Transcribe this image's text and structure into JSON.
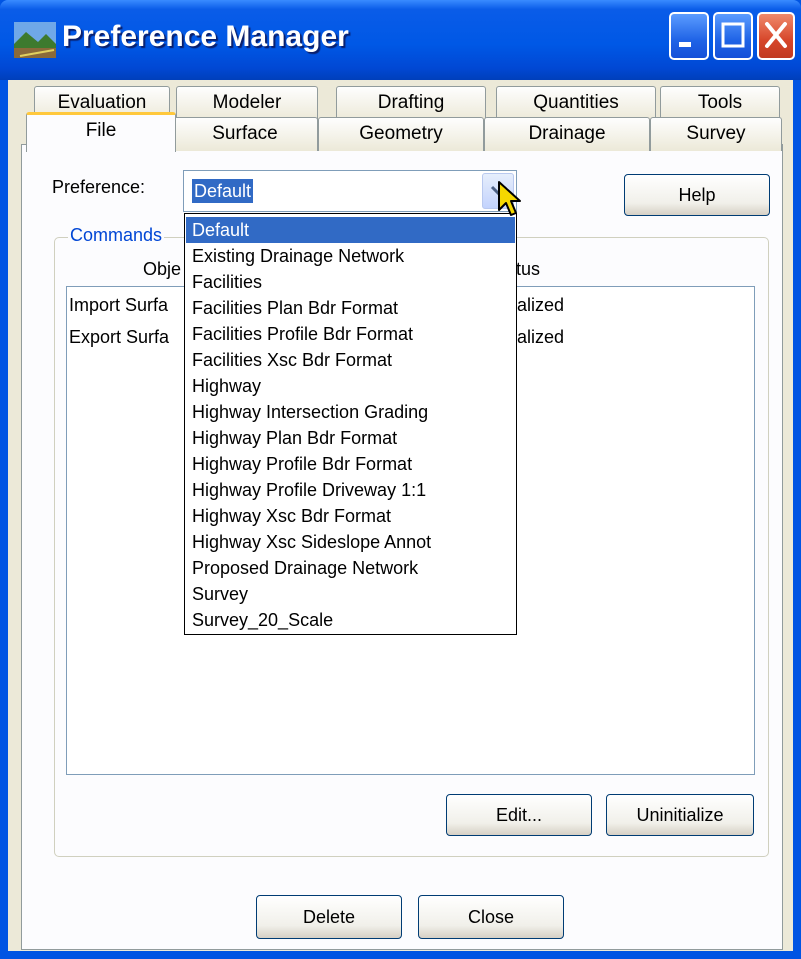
{
  "window": {
    "title": "Preference Manager"
  },
  "tabs_back": [
    "Evaluation",
    "Modeler",
    "Drafting",
    "Quantities",
    "Tools"
  ],
  "tabs_front": [
    "File",
    "Surface",
    "Geometry",
    "Drainage",
    "Survey"
  ],
  "active_tab": "File",
  "preference": {
    "label": "Preference:",
    "value": "Default"
  },
  "help_button": "Help",
  "commands": {
    "group_title": "Commands",
    "columns": [
      "Obje",
      "tus"
    ],
    "rows": [
      {
        "object": "Import Surfa",
        "status": "alized"
      },
      {
        "object": "Export Surfa",
        "status": "alized"
      }
    ]
  },
  "dropdown_options": [
    "Default",
    "Existing Drainage Network",
    "Facilities",
    "Facilities Plan Bdr Format",
    "Facilities Profile Bdr Format",
    "Facilities Xsc Bdr Format",
    "Highway",
    "Highway Intersection Grading",
    "Highway Plan Bdr Format",
    "Highway Profile Bdr Format",
    "Highway Profile Driveway 1:1",
    "Highway Xsc Bdr Format",
    "Highway Xsc Sideslope Annot",
    "Proposed Drainage Network",
    "Survey",
    "Survey_20_Scale"
  ],
  "buttons": {
    "edit": "Edit...",
    "uninitialize": "Uninitialize",
    "delete": "Delete",
    "close": "Close"
  },
  "colors": {
    "title_bar": "#0054e3",
    "selection": "#316ac5",
    "dialog_bg": "#ece9d8",
    "group_title": "#0046d5"
  }
}
